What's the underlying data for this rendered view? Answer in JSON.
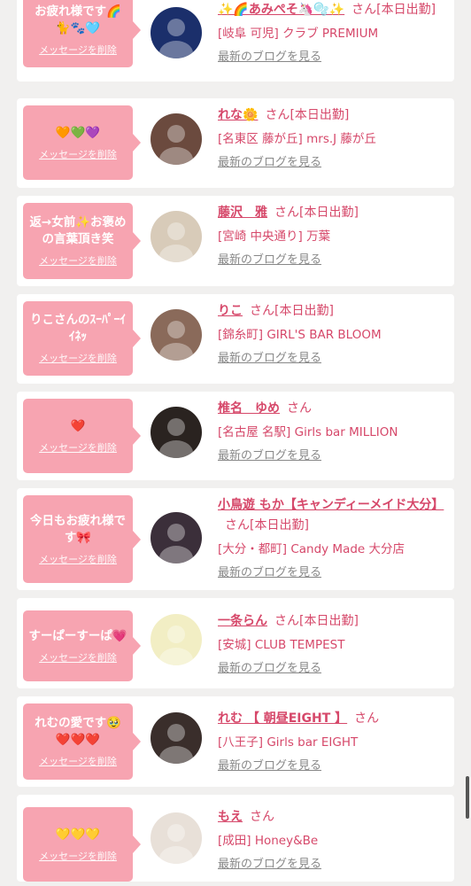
{
  "labels": {
    "san": "さん",
    "delete": "メッセージを削除",
    "blog": "最新のブログを見る"
  },
  "colors": {
    "bubble": "#f7a4b1",
    "accent": "#d6486a",
    "link_gray": "#888888",
    "background": "#f1f0ef"
  },
  "messages": [
    {
      "message": "お疲れ様です🌈🐈🐾🩵",
      "name": "✨🌈あみぺそ🦄🫧✨",
      "status": "[本日出勤]",
      "shop": "[岐阜 可児] クラブ PREMIUM",
      "avatar_icon": "avatar-photo-icon",
      "avatar_color": "#1b2f6b"
    },
    {
      "message": "🧡💚💜",
      "name": "れな🌼",
      "status": "[本日出勤]",
      "shop": "[名東区 藤が丘] mrs.J 藤が丘",
      "avatar_icon": "avatar-photo-icon",
      "avatar_color": "#6b4a3e"
    },
    {
      "message": "返→女前✨お褒めの言葉頂き笑",
      "name": "藤沢　雅",
      "status": "[本日出勤]",
      "shop": "[宮崎 中央通り] 万葉",
      "avatar_icon": "avatar-photo-icon",
      "avatar_color": "#d8cbb9"
    },
    {
      "message": "りこさんのｽｰﾊﾟｰｲｲﾈｯ",
      "name": "りこ",
      "status": "[本日出勤]",
      "shop": "[錦糸町] GIRL'S BAR BLOOM",
      "avatar_icon": "avatar-photo-icon",
      "avatar_color": "#8a6a5a"
    },
    {
      "message": "❤️",
      "name": "椎名　ゆめ",
      "status": "",
      "shop": "[名古屋 名駅] Girls bar MILLION",
      "avatar_icon": "avatar-photo-icon",
      "avatar_color": "#2a2320"
    },
    {
      "message": "今日もお疲れ様です🎀",
      "name": "小鳥遊 もか【キャンディーメイド大分】",
      "status": "[本日出勤]",
      "shop": "[大分・都町] Candy Made 大分店",
      "avatar_icon": "avatar-photo-icon",
      "avatar_color": "#3b2f3a"
    },
    {
      "message": "すーぱーすーぱ💗",
      "name": "一条らん",
      "status": "[本日出勤]",
      "shop": "[安城] CLUB TEMPEST",
      "avatar_icon": "avatar-photo-icon",
      "avatar_color": "#f2eec4"
    },
    {
      "message": "れむの愛です🥹❤️❤️❤️",
      "name": "れむ 【 朝昼EIGHT 】",
      "status": "",
      "shop": "[八王子] Girls bar EIGHT",
      "avatar_icon": "avatar-photo-icon",
      "avatar_color": "#3a2e2b"
    },
    {
      "message": "💛💛💛",
      "name": "もえ",
      "status": "",
      "shop": "[成田] Honey&Be",
      "avatar_icon": "avatar-photo-icon",
      "avatar_color": "#e8e0d8"
    }
  ]
}
